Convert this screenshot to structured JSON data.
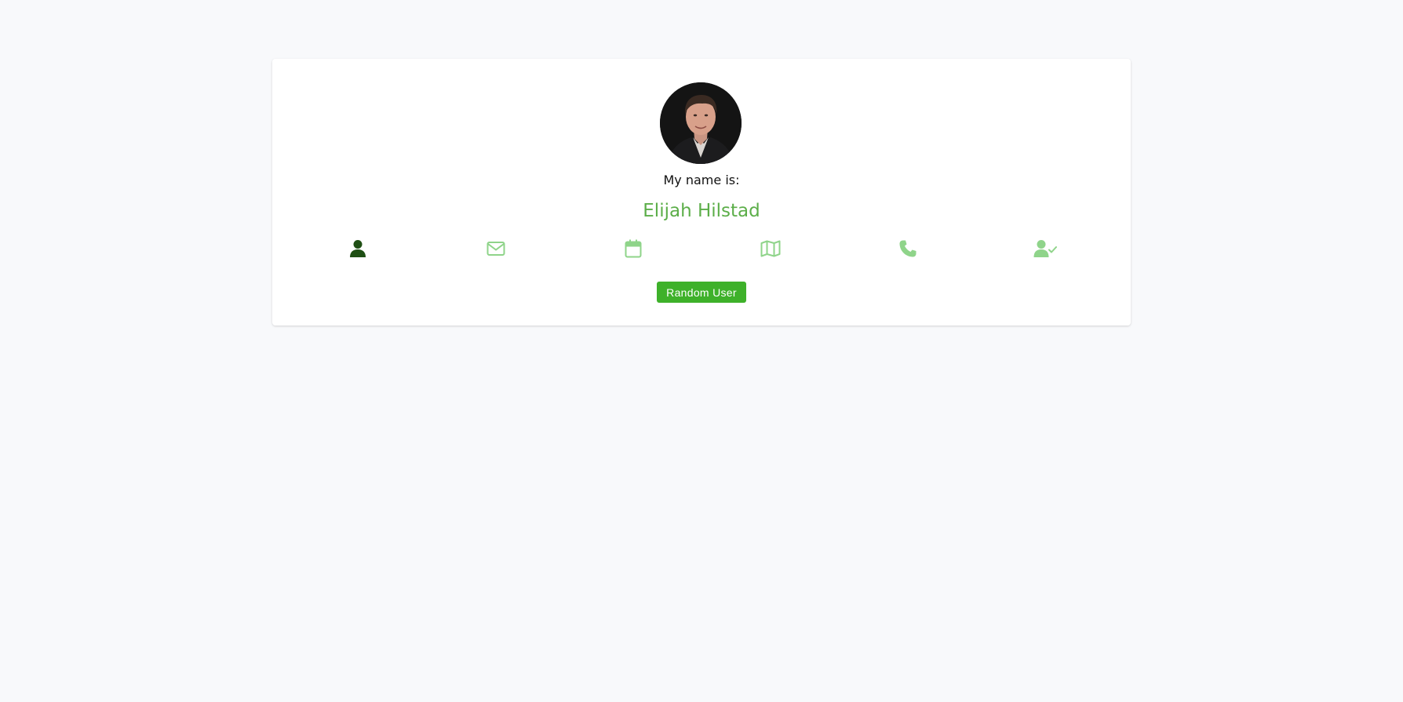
{
  "profile": {
    "label": "My name is:",
    "value": "Elijah Hilstad"
  },
  "icons": [
    {
      "name": "user-icon",
      "active": true
    },
    {
      "name": "envelope-icon",
      "active": false
    },
    {
      "name": "calendar-icon",
      "active": false
    },
    {
      "name": "map-icon",
      "active": false
    },
    {
      "name": "phone-icon",
      "active": false
    },
    {
      "name": "user-check-icon",
      "active": false
    }
  ],
  "button": {
    "label": "Random User"
  },
  "colors": {
    "accent": "#5cae49",
    "icon_active": "#1f4f14",
    "icon_inactive": "#8fd48a",
    "button_bg": "#3eb12a",
    "background": "#f8f9fb"
  }
}
